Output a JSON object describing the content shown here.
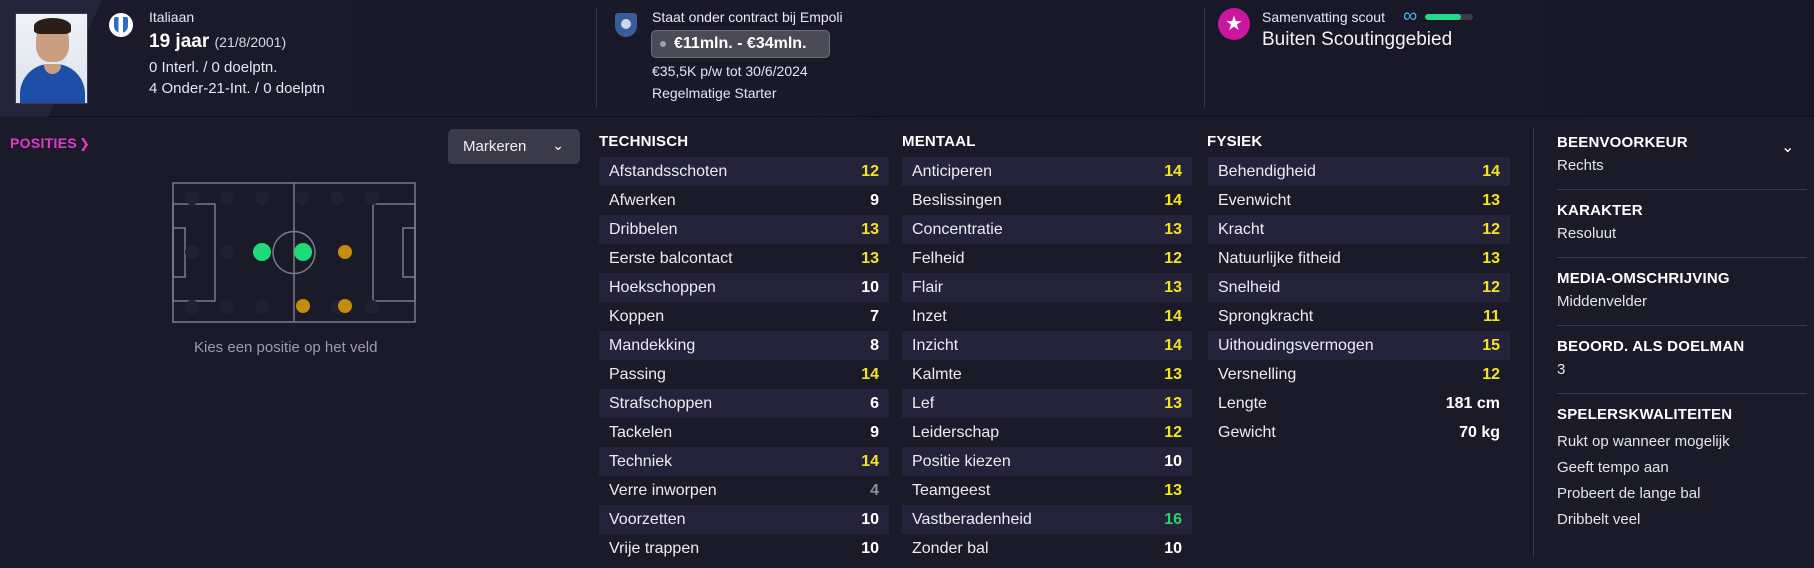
{
  "header": {
    "nationality": "Italiaan",
    "age": "19 jaar",
    "dob": "(21/8/2001)",
    "international": "0 Interl. / 0 doelptn.",
    "u21": "4 Onder-21-Int. / 0 doelptn",
    "contract": "Staat onder contract bij Empoli",
    "value_range": "€11mln. - €34mln.",
    "wage": "€35,5K p/w tot 30/6/2024",
    "role": "Regelmatige Starter",
    "scout_label": "Samenvatting scout",
    "scout_status": "Buiten Scoutinggebied",
    "scout_knowledge_fraction": 0.75,
    "icons": {
      "star": "star-icon",
      "infinity": "infinity-icon"
    },
    "colors": {
      "accent": "#c9189e",
      "scout_bar": "#26d98a"
    }
  },
  "positions": {
    "link_label": "POSITIES",
    "mark_button_label": "Markeren",
    "hint": "Kies een positie op het veld"
  },
  "technical": {
    "title": "TECHNISCH",
    "items": [
      {
        "label": "Afstandsschoten",
        "value": "12",
        "color": "yellow"
      },
      {
        "label": "Afwerken",
        "value": "9",
        "color": "white"
      },
      {
        "label": "Dribbelen",
        "value": "13",
        "color": "yellow"
      },
      {
        "label": "Eerste balcontact",
        "value": "13",
        "color": "yellow"
      },
      {
        "label": "Hoekschoppen",
        "value": "10",
        "color": "white"
      },
      {
        "label": "Koppen",
        "value": "7",
        "color": "white"
      },
      {
        "label": "Mandekking",
        "value": "8",
        "color": "white"
      },
      {
        "label": "Passing",
        "value": "14",
        "color": "yellow"
      },
      {
        "label": "Strafschoppen",
        "value": "6",
        "color": "white"
      },
      {
        "label": "Tackelen",
        "value": "9",
        "color": "white"
      },
      {
        "label": "Techniek",
        "value": "14",
        "color": "yellow"
      },
      {
        "label": "Verre inworpen",
        "value": "4",
        "color": "grey"
      },
      {
        "label": "Voorzetten",
        "value": "10",
        "color": "white"
      },
      {
        "label": "Vrije trappen",
        "value": "10",
        "color": "white"
      }
    ]
  },
  "mental": {
    "title": "MENTAAL",
    "items": [
      {
        "label": "Anticiperen",
        "value": "14",
        "color": "yellow"
      },
      {
        "label": "Beslissingen",
        "value": "14",
        "color": "yellow"
      },
      {
        "label": "Concentratie",
        "value": "13",
        "color": "yellow"
      },
      {
        "label": "Felheid",
        "value": "12",
        "color": "yellow"
      },
      {
        "label": "Flair",
        "value": "13",
        "color": "yellow"
      },
      {
        "label": "Inzet",
        "value": "14",
        "color": "yellow"
      },
      {
        "label": "Inzicht",
        "value": "14",
        "color": "yellow"
      },
      {
        "label": "Kalmte",
        "value": "13",
        "color": "yellow"
      },
      {
        "label": "Lef",
        "value": "13",
        "color": "yellow"
      },
      {
        "label": "Leiderschap",
        "value": "12",
        "color": "yellow"
      },
      {
        "label": "Positie kiezen",
        "value": "10",
        "color": "white"
      },
      {
        "label": "Teamgeest",
        "value": "13",
        "color": "yellow"
      },
      {
        "label": "Vastberadenheid",
        "value": "16",
        "color": "green"
      },
      {
        "label": "Zonder bal",
        "value": "10",
        "color": "white"
      }
    ]
  },
  "physical": {
    "title": "FYSIEK",
    "items": [
      {
        "label": "Behendigheid",
        "value": "14",
        "color": "yellow"
      },
      {
        "label": "Evenwicht",
        "value": "13",
        "color": "yellow"
      },
      {
        "label": "Kracht",
        "value": "12",
        "color": "yellow"
      },
      {
        "label": "Natuurlijke fitheid",
        "value": "13",
        "color": "yellow"
      },
      {
        "label": "Snelheid",
        "value": "12",
        "color": "yellow"
      },
      {
        "label": "Sprongkracht",
        "value": "11",
        "color": "yellow"
      },
      {
        "label": "Uithoudingsvermogen",
        "value": "15",
        "color": "yellow"
      },
      {
        "label": "Versnelling",
        "value": "12",
        "color": "yellow"
      }
    ],
    "height_label": "Lengte",
    "height_value": "181 cm",
    "weight_label": "Gewicht",
    "weight_value": "70 kg"
  },
  "info": {
    "foot_title": "BEENVOORKEUR",
    "foot_value": "Rechts",
    "personality_title": "KARAKTER",
    "personality_value": "Resoluut",
    "media_title": "MEDIA-OMSCHRIJVING",
    "media_value": "Middenvelder",
    "gk_title": "BEOORD. ALS DOELMAN",
    "gk_value": "3",
    "traits_title": "SPELERSKWALITEITEN",
    "traits": [
      "Rukt op wanneer mogelijk",
      "Geeft tempo aan",
      "Probeert de lange bal",
      "Dribbelt veel"
    ]
  }
}
